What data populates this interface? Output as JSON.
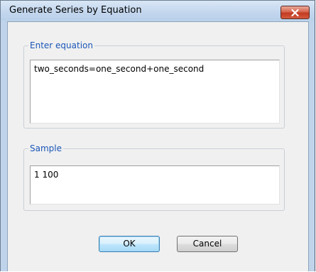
{
  "window": {
    "title": "Generate Series by Equation",
    "close_icon": "close-icon",
    "accent_color": "#c23a22"
  },
  "equation_group": {
    "label": "Enter equation",
    "value": "two_seconds=one_second+one_second"
  },
  "sample_group": {
    "label": "Sample",
    "value": "1 100"
  },
  "buttons": {
    "ok_label": "OK",
    "cancel_label": "Cancel"
  }
}
